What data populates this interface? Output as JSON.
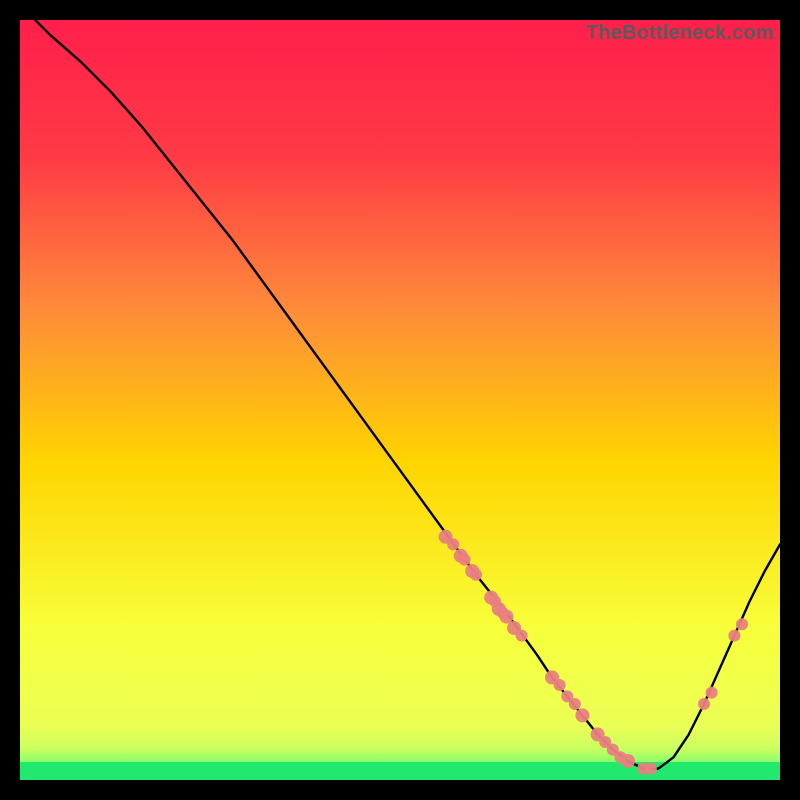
{
  "watermark": "TheBottleneck.com",
  "colors": {
    "gradient_top": "#ff1f4b",
    "gradient_mid_upper": "#ff6a3a",
    "gradient_mid": "#ffd400",
    "gradient_mid_lower": "#f7ff3a",
    "gradient_bottom_band": "#2fff7a",
    "curve_stroke": "#000000",
    "point_fill": "#e98080",
    "background": "#000000"
  },
  "chart_data": {
    "type": "line",
    "title": "",
    "xlabel": "",
    "ylabel": "",
    "xlim": [
      0,
      100
    ],
    "ylim": [
      0,
      100
    ],
    "series": [
      {
        "name": "bottleneck-curve",
        "x": [
          2,
          4,
          8,
          12,
          16,
          20,
          24,
          28,
          32,
          36,
          40,
          44,
          48,
          52,
          56,
          60,
          64,
          68,
          70,
          72,
          74,
          76,
          78,
          80,
          82,
          84,
          86,
          88,
          90,
          92,
          94,
          96,
          98,
          100
        ],
        "y": [
          100,
          98,
          94.5,
          90.5,
          86,
          81,
          76,
          71,
          65.5,
          60,
          54.5,
          49,
          43.5,
          38,
          32.5,
          27,
          22,
          16.5,
          13.5,
          11,
          8.5,
          6,
          4,
          2.5,
          1.5,
          1.5,
          3,
          6,
          10,
          14.5,
          19,
          23.5,
          27.5,
          31
        ]
      }
    ],
    "points": {
      "name": "highlight-points",
      "x": [
        56,
        57,
        58,
        58.5,
        59.5,
        60,
        62,
        62.5,
        63,
        63.5,
        64,
        65,
        66,
        70,
        71,
        72,
        73,
        74,
        76,
        77,
        78,
        79,
        80,
        82,
        83,
        90,
        91,
        94,
        95
      ],
      "y": [
        32,
        31,
        29.5,
        29,
        27.5,
        27,
        24,
        23.5,
        22.5,
        22,
        21.5,
        20,
        19,
        13.5,
        12.5,
        11,
        10,
        8.5,
        6,
        5,
        4,
        3,
        2.5,
        1.5,
        1.5,
        10,
        11.5,
        19,
        20.5
      ],
      "r": [
        7,
        6,
        7,
        6,
        7,
        6,
        7,
        6,
        7,
        6,
        7,
        7,
        6,
        7,
        6,
        6,
        6,
        7,
        7,
        6,
        6,
        6,
        7,
        6,
        6,
        6,
        6,
        6,
        6
      ]
    }
  }
}
